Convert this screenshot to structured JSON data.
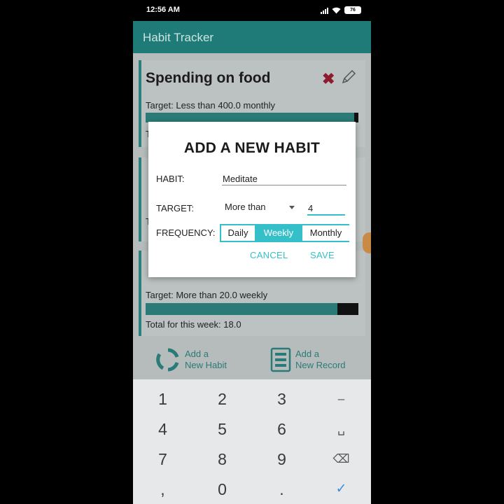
{
  "status_bar": {
    "time": "12:56 AM",
    "battery": "76"
  },
  "app_bar": {
    "title": "Habit Tracker"
  },
  "background": {
    "card1": {
      "name": "Spending on food",
      "target": "Target: Less than 400.0 monthly",
      "partial_text": "T"
    },
    "card2": {
      "partial_text": "T"
    },
    "card3": {
      "target": "Target: More than 20.0 weekly",
      "total": "Total for this week: 18.0",
      "progress": 0.9
    },
    "actions": [
      {
        "line1": "Add a",
        "line2": "New Habit"
      },
      {
        "line1": "Add a",
        "line2": "New Record"
      }
    ]
  },
  "dialog": {
    "title": "ADD A NEW HABIT",
    "habit_label": "HABIT:",
    "habit_value": "Meditate",
    "target_label": "TARGET:",
    "target_mode": "More than",
    "target_value": "4",
    "frequency_label": "FREQUENCY:",
    "frequency_options": [
      "Daily",
      "Weekly",
      "Monthly"
    ],
    "frequency_selected": "Weekly",
    "cancel_label": "CANCEL",
    "save_label": "SAVE"
  },
  "keyboard": {
    "keys": [
      "1",
      "2",
      "3",
      "–",
      "4",
      "5",
      "6",
      "␣",
      "7",
      "8",
      "9",
      "⌫",
      ",",
      "0",
      ".",
      "✓"
    ]
  },
  "colors": {
    "accent": "#35c0c9",
    "primary": "#1e7b78"
  }
}
